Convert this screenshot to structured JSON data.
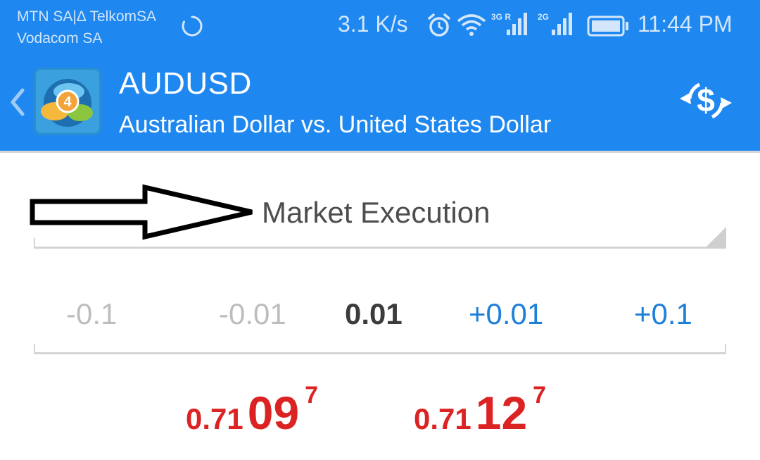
{
  "status_bar": {
    "carrier_line1": "MTN SA|Δ TelkomSA",
    "carrier_line2": "Vodacom SA",
    "network_speed": "3.1 K/s",
    "signal1_label": "3G R",
    "signal2_label": "2G",
    "time": "11:44 PM"
  },
  "app_bar": {
    "symbol": "AUDUSD",
    "description": "Australian Dollar vs. United States Dollar",
    "logo_badge": "4"
  },
  "order": {
    "execution_type": "Market Execution",
    "volume": {
      "dec_large": "-0.1",
      "dec_small": "-0.01",
      "value": "0.01",
      "inc_small": "+0.01",
      "inc_large": "+0.1"
    }
  },
  "quotes": {
    "bid": {
      "prefix": "0.71",
      "big": "09",
      "sup": "7"
    },
    "ask": {
      "prefix": "0.71",
      "big": "12",
      "sup": "7"
    }
  },
  "colors": {
    "bar_blue": "#1e88f0",
    "price_red": "#dc2323",
    "step_blue": "#1e7fd8"
  }
}
